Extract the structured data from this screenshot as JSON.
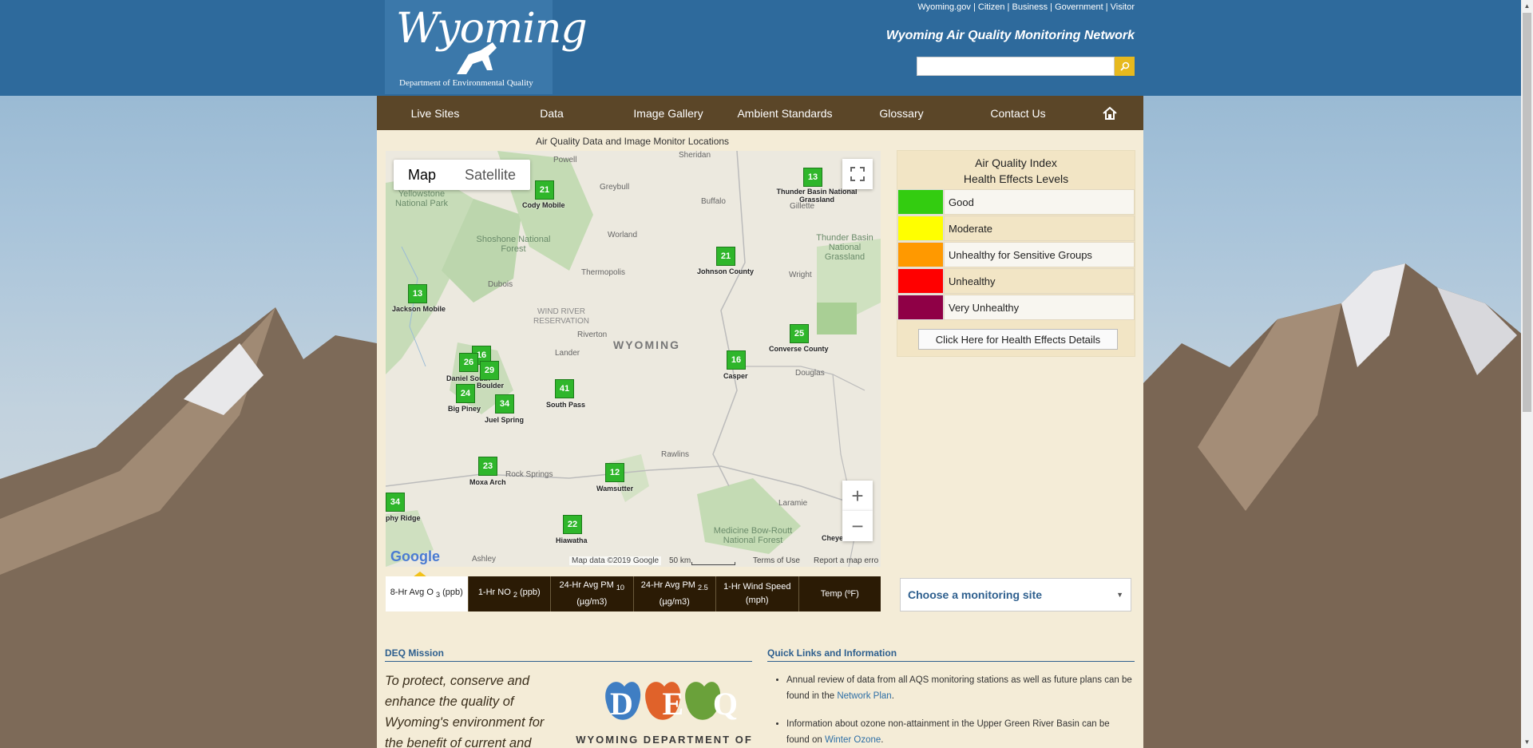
{
  "header": {
    "logo_script": "Wyoming",
    "logo_sub": "Department of Environmental Quality",
    "util_links": [
      "Wyoming.gov",
      "Citizen",
      "Business",
      "Government",
      "Visitor"
    ],
    "network_title": "Wyoming Air Quality Monitoring Network",
    "search_placeholder": "",
    "search_icon": "magnifier-icon"
  },
  "nav": {
    "items": [
      "Live Sites",
      "Data",
      "Image Gallery",
      "Ambient Standards",
      "Glossary",
      "Contact Us"
    ],
    "home_icon": "home-icon"
  },
  "map": {
    "caption": "Air Quality Data and Image Monitor Locations",
    "toggle": [
      "Map",
      "Satellite"
    ],
    "active_toggle": "Map",
    "state_label": "WYOMING",
    "footer": {
      "logo": "Google",
      "data": "Map data ©2019 Google",
      "scale": "50 km",
      "terms": "Terms of Use",
      "report": "Report a map erro"
    },
    "sites": [
      {
        "value": "21",
        "label": "Cody Mobile"
      },
      {
        "value": "13",
        "label": "Thunder Basin National Grassland"
      },
      {
        "value": "21",
        "label": "Johnson County"
      },
      {
        "value": "13",
        "label": "Jackson Mobile"
      },
      {
        "value": "25",
        "label": "Converse County"
      },
      {
        "value": "16",
        "label": "Casper"
      },
      {
        "value": "16",
        "label": ""
      },
      {
        "value": "26",
        "label": "Daniel South"
      },
      {
        "value": "29",
        "label": "Boulder"
      },
      {
        "value": "24",
        "label": "Big Piney"
      },
      {
        "value": "34",
        "label": "Juel Spring"
      },
      {
        "value": "41",
        "label": "South Pass"
      },
      {
        "value": "23",
        "label": "Moxa Arch"
      },
      {
        "value": "12",
        "label": "Wamsutter"
      },
      {
        "value": "34",
        "label": "phy Ridge"
      },
      {
        "value": "22",
        "label": "Hiawatha"
      },
      {
        "value": "",
        "label": "Cheyen"
      }
    ],
    "places": [
      "Powell",
      "Sheridan",
      "Greybull",
      "Buffalo",
      "Gillette",
      "Worland",
      "Thermopolis",
      "Dubois",
      "Riverton",
      "Lander",
      "Douglas",
      "Rawlins",
      "Rock Springs",
      "Laramie",
      "Wright",
      "Ashley",
      "Yellowstone National Park",
      "Shoshone National Forest",
      "WIND RIVER RESERVATION",
      "Thunder Basin National Grassland",
      "Medicine Bow-Routt National Forest"
    ]
  },
  "tabs": [
    {
      "label": "8-Hr Avg O",
      "sub": "3",
      "suffix": " (ppb)"
    },
    {
      "label": "1-Hr NO",
      "sub": "2",
      "suffix": " (ppb)"
    },
    {
      "label": "24-Hr Avg PM",
      "sub": "10",
      "suffix": " (µg/m3)"
    },
    {
      "label": "24-Hr Avg PM",
      "sub": "2.5",
      "suffix": " (µg/m3)"
    },
    {
      "label": "1-Hr Wind Speed (mph)",
      "sub": "",
      "suffix": ""
    },
    {
      "label": "Temp (ºF)",
      "sub": "",
      "suffix": ""
    }
  ],
  "aqi": {
    "title_line1": "Air Quality Index",
    "title_line2": "Health Effects Levels",
    "levels": [
      {
        "label": "Good",
        "color": "#33cc10"
      },
      {
        "label": "Moderate",
        "color": "#ffff00"
      },
      {
        "label": "Unhealthy for Sensitive Groups",
        "color": "#ff9900"
      },
      {
        "label": "Unhealthy",
        "color": "#ff0000"
      },
      {
        "label": "Very Unhealthy",
        "color": "#8f0046"
      }
    ],
    "button": "Click Here for Health Effects Details"
  },
  "site_select": {
    "selected": "Choose a monitoring site"
  },
  "mission": {
    "heading": "DEQ Mission",
    "text": "To protect, conserve and enhance the quality of Wyoming's environment for the benefit of current and",
    "logo_letters": [
      "D",
      "E",
      "Q"
    ],
    "logo_sub": "WYOMING DEPARTMENT OF"
  },
  "quick_links": {
    "heading": "Quick Links and Information",
    "items": [
      {
        "text": "Annual review of data from all AQS monitoring stations as well as future plans can be found in the ",
        "link": "Network Plan",
        "tail": "."
      },
      {
        "text": "Information about ozone non-attainment in the Upper Green River Basin can be found on ",
        "link": "Winter Ozone",
        "tail": "."
      }
    ]
  },
  "colors": {
    "header_blue": "#2e6a9c",
    "nav_brown": "#5b4628",
    "content_bg": "#f4ecd7",
    "marker_green": "#2fb62b",
    "search_btn": "#e7b91e"
  }
}
